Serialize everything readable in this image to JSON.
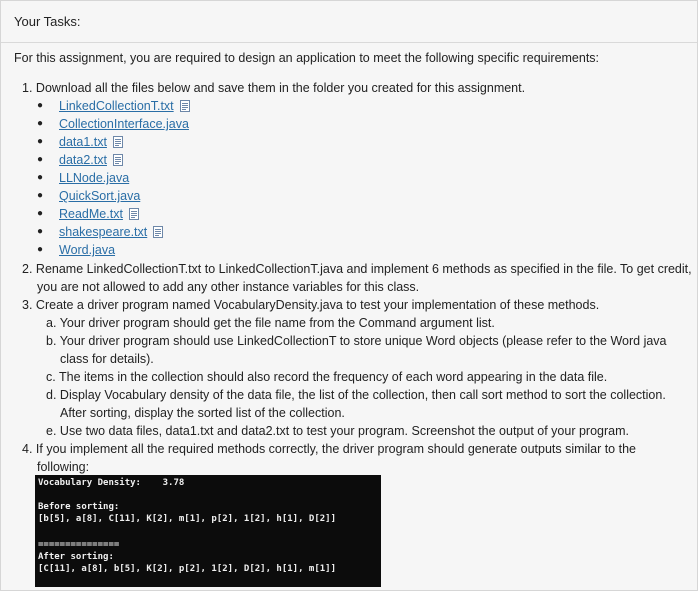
{
  "heading": "Your Tasks:",
  "intro": "For this assignment, you are required to design an application to meet the following specific requirements:",
  "items": [
    {
      "num": "1.",
      "text": "Download all the files below and save them in the folder you created for this assignment."
    },
    {
      "num": "2.",
      "text_lines": [
        "Rename LinkedCollectionT.txt to LinkedCollectionT.java and implement 6 methods as specified in the file. To get credit,",
        "you are not allowed to add any other instance variables for this class."
      ]
    },
    {
      "num": "3.",
      "text": "Create a driver program named VocabularyDensity.java to test your implementation of these methods."
    },
    {
      "num": "4.",
      "text_lines": [
        "If you implement all the required methods correctly, the driver program should generate outputs similar to the",
        "following:"
      ]
    }
  ],
  "files": [
    {
      "name": "LinkedCollectionT.txt",
      "icon": "download-icon"
    },
    {
      "name": "CollectionInterface.java",
      "icon": ""
    },
    {
      "name": "data1.txt",
      "icon": "download-icon"
    },
    {
      "name": "data2.txt",
      "icon": "download-icon"
    },
    {
      "name": "LLNode.java",
      "icon": ""
    },
    {
      "name": "QuickSort.java",
      "icon": ""
    },
    {
      "name": "ReadMe.txt",
      "icon": "download-icon"
    },
    {
      "name": "shakespeare.txt",
      "icon": "download-icon"
    },
    {
      "name": "Word.java",
      "icon": ""
    }
  ],
  "subitems": [
    {
      "letter": "a.",
      "lines": [
        "Your driver program should get the file name from the Command argument list."
      ]
    },
    {
      "letter": "b.",
      "lines": [
        "Your driver program should use LinkedCollectionT to store unique Word objects (please refer to the Word java",
        "class for details)."
      ]
    },
    {
      "letter": "c.",
      "lines": [
        "The items in the collection should also record the frequency of each word appearing in the data file."
      ]
    },
    {
      "letter": "d.",
      "lines": [
        "Display Vocabulary density of the data file, the list of the collection, then call sort method to sort the collection.",
        "After sorting, display the sorted list of the collection."
      ]
    },
    {
      "letter": "e.",
      "lines": [
        "Use two data files, data1.txt and data2.txt to test your program. Screenshot the output of your program."
      ]
    }
  ],
  "terminal": {
    "line1": "Vocabulary Density:    3.78",
    "line2": "Before sorting:",
    "line3": "[b[5], a[8], C[11], K[2], m[1], p[2], 1[2], h[1], D[2]]",
    "line4": "===============",
    "line5": "After sorting:",
    "line6": "[C[11], a[8], b[5], K[2], p[2], 1[2], D[2], h[1], m[1]]"
  }
}
